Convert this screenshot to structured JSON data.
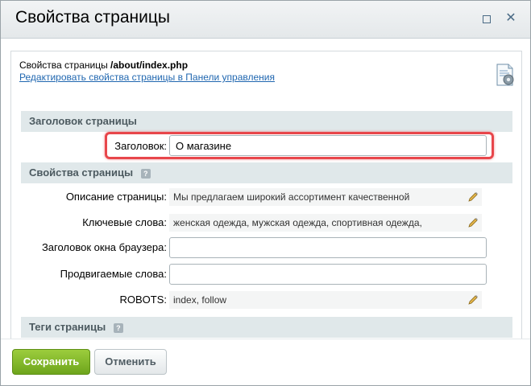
{
  "window": {
    "title": "Свойства страницы"
  },
  "info": {
    "prefix": "Свойства страницы",
    "path": "/about/index.php",
    "link_text": "Редактировать свойства страницы в Панели управления"
  },
  "sections": {
    "page_title_header": "Заголовок страницы",
    "page_props_header": "Свойства страницы",
    "page_tags_header": "Теги страницы"
  },
  "fields": {
    "title_label": "Заголовок:",
    "title_value": "О магазине",
    "description_label": "Описание страницы:",
    "description_value": "Мы предлагаем широкий ассортимент качественной",
    "keywords_label": "Ключевые слова:",
    "keywords_value": "женская одежда, мужская одежда, спортивная одежда,",
    "browser_title_label": "Заголовок окна браузера:",
    "browser_title_value": "",
    "promoted_label": "Продвигаемые слова:",
    "promoted_value": "",
    "robots_label": "ROBOTS:",
    "robots_value": "index, follow"
  },
  "buttons": {
    "save": "Сохранить",
    "cancel": "Отменить"
  },
  "colors": {
    "accent_link": "#2067b0",
    "highlight": "#e8464b",
    "save_button": "#7fb82a",
    "section_header_bg": "#e0e8ea"
  }
}
